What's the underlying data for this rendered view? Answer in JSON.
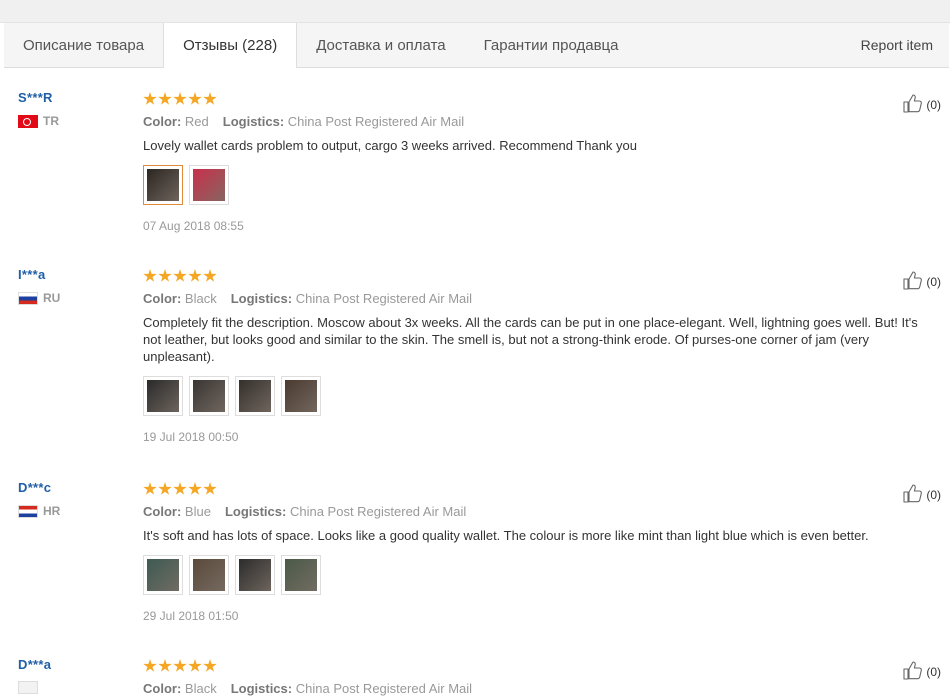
{
  "tabs": [
    {
      "label": "Описание товара"
    },
    {
      "label": "Отзывы (228)"
    },
    {
      "label": "Доставка и оплата"
    },
    {
      "label": "Гарантии продавца"
    }
  ],
  "report_label": "Report item",
  "color_label": "Color:",
  "logistics_label": "Logistics:",
  "reviews": [
    {
      "user": "S***R",
      "country": "TR",
      "flag": "tr",
      "rating": 5,
      "color": "Red",
      "logistics": "China Post Registered Air Mail",
      "text": "Lovely wallet cards problem to output, cargo 3 weeks arrived. Recommend Thank you",
      "photos": [
        "#2b2622",
        "#c8304a"
      ],
      "date": "07 Aug 2018 08:55",
      "likes": "(0)"
    },
    {
      "user": "I***a",
      "country": "RU",
      "flag": "ru",
      "rating": 5,
      "color": "Black",
      "logistics": "China Post Registered Air Mail",
      "text": "Completely fit the description. Moscow about 3x weeks. All the cards can be put in one place-elegant. Well, lightning goes well. But! It's not leather, but looks good and similar to the skin. The smell is, but not a strong-think erode. Of purses-one corner of jam (very unpleasant).",
      "photos": [
        "#2a2a2a",
        "#3a3634",
        "#35302c",
        "#4a3a30"
      ],
      "date": "19 Jul 2018 00:50",
      "likes": "(0)"
    },
    {
      "user": "D***c",
      "country": "HR",
      "flag": "hr",
      "rating": 5,
      "color": "Blue",
      "logistics": "China Post Registered Air Mail",
      "text": "It's soft and has lots of space. Looks like a good quality wallet. The colour is more like mint than light blue which is even better.",
      "photos": [
        "#3d5a52",
        "#5a4a3a",
        "#2c2c2c",
        "#4a5a48"
      ],
      "date": "29 Jul 2018 01:50",
      "likes": "(0)"
    },
    {
      "user": "D***a",
      "country": "",
      "flag": "blank",
      "rating": 5,
      "color": "Black",
      "logistics": "China Post Registered Air Mail",
      "text": "",
      "photos": [],
      "date": "",
      "likes": "(0)"
    }
  ]
}
